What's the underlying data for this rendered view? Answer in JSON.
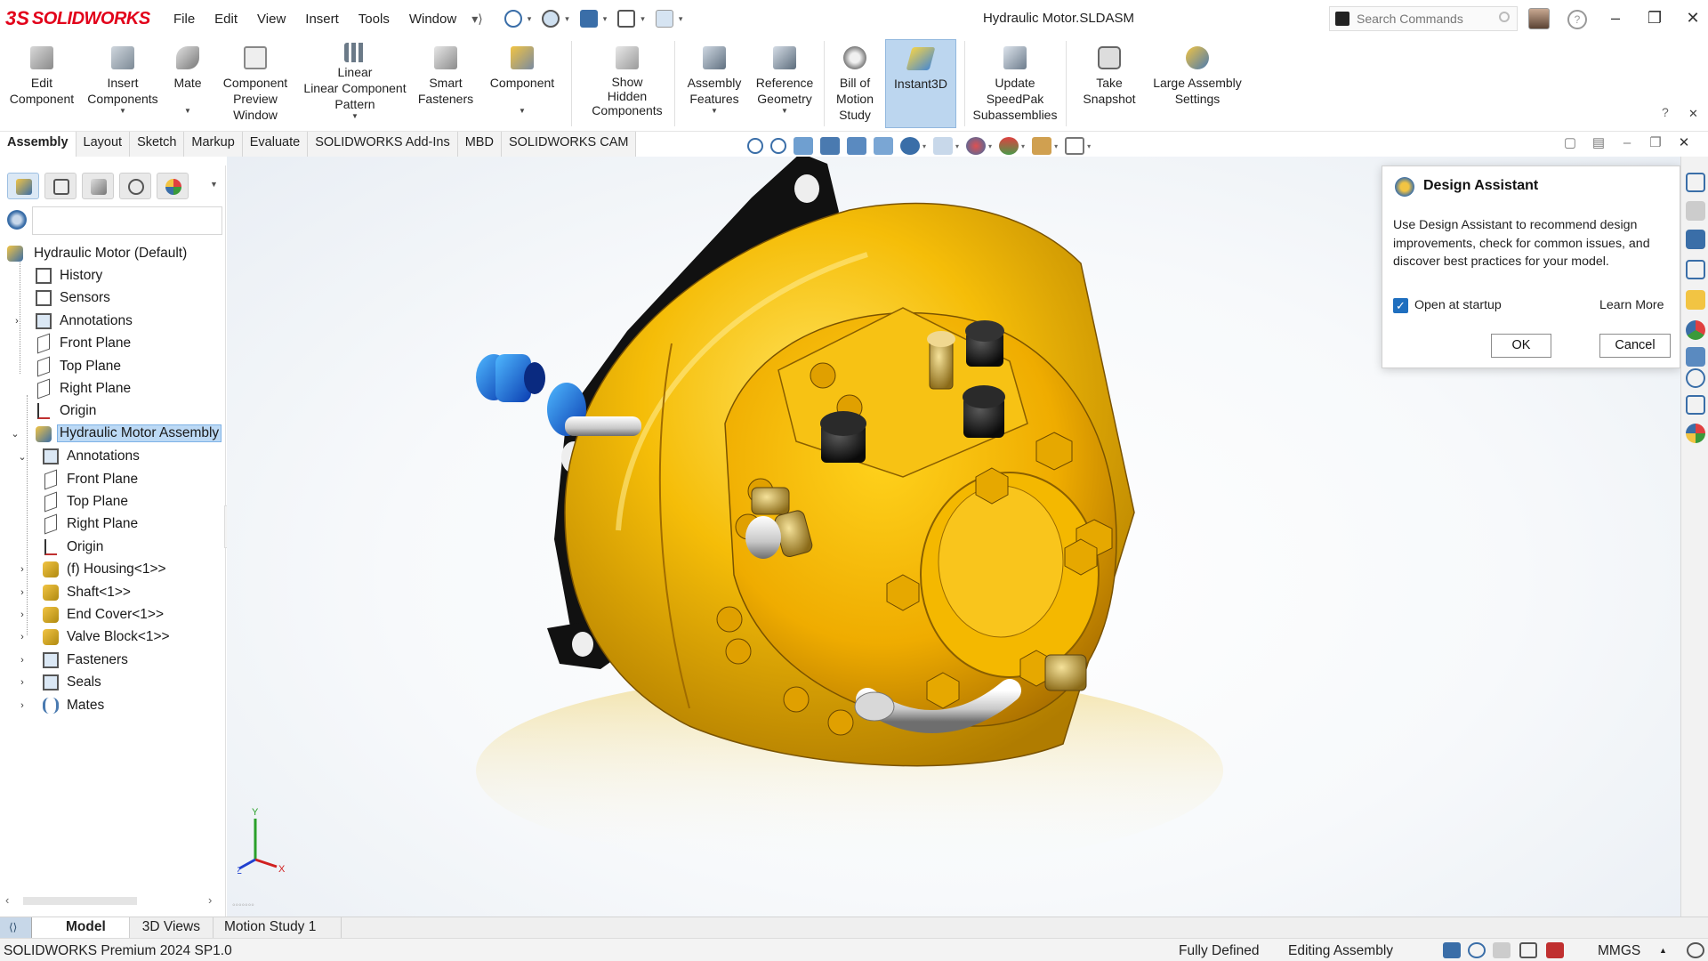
{
  "app": {
    "logo_ds": "3S",
    "logo_name": "SOLIDWORKS",
    "document_title": "Hydraulic Motor.SLDASM"
  },
  "menu": [
    "File",
    "Edit",
    "View",
    "Insert",
    "Tools",
    "Window"
  ],
  "search": {
    "placeholder": "Search Commands"
  },
  "ribbon": {
    "edit_component": "Edit\nComponent",
    "insert_components": "Insert\nComponents",
    "mate": "Mate",
    "component_preview": "Component\nPreview\nWindow",
    "linear_pattern": "Linear\nLinear Component\nPattern",
    "smart_fasteners": "Smart\nFasteners",
    "component": "Component",
    "show_hidden": "Show\nHidden\nComponents",
    "assembly_features": "Assembly\nFeatures",
    "reference_geometry": "Reference\nGeometry",
    "bill_of_motion": "Bill of\nMotion\nStudy",
    "instant3d": "Instant3D",
    "update_speedpak": "Update\nSpeedPak\nSubassemblies",
    "take_snapshot": "Take\nSnapshot",
    "large_assembly": "Large Assembly\nSettings"
  },
  "cm_tabs": [
    "Assembly",
    "Layout",
    "Sketch",
    "Markup",
    "Evaluate",
    "SOLIDWORKS Add-Ins",
    "MBD",
    "SOLIDWORKS CAM"
  ],
  "tree": {
    "root": "Hydraulic Motor  (Default)",
    "items": [
      "History",
      "Sensors",
      "Annotations",
      "Front Plane",
      "Top Plane",
      "Right Plane",
      "Origin",
      "Hydraulic Motor Assembly",
      "Annotations",
      "Front Plane",
      "Top Plane",
      "Right Plane",
      "Origin",
      "(f) Housing<1>>",
      "Shaft<1>>",
      "End Cover<1>>",
      "Valve Block<1>>",
      "Fasteners",
      "Seals",
      "Mates"
    ]
  },
  "triad": {
    "x": "X",
    "y": "Y",
    "z": "Z"
  },
  "design_assistant": {
    "title": "Design Assistant",
    "body": "Use Design Assistant to recommend design improvements, check for common issues, and discover best practices for your model.",
    "checkbox_label": "Open at startup",
    "checkbox_checked": true,
    "learn_more": "Learn More",
    "ok": "OK",
    "cancel": "Cancel"
  },
  "bottom_tabs": {
    "model": "Model",
    "views": "3D Views",
    "motion": "Motion Study 1"
  },
  "status": {
    "product": "SOLIDWORKS Premium 2024 SP1.0",
    "fully_defined": "Fully Defined",
    "editing": "Editing Assembly",
    "units": "MMGS"
  },
  "colors": {
    "accent": "#1f6fbf",
    "selection": "#bcd9f5",
    "model_yellow": "#f2b705",
    "brand_red": "#e2001a"
  }
}
